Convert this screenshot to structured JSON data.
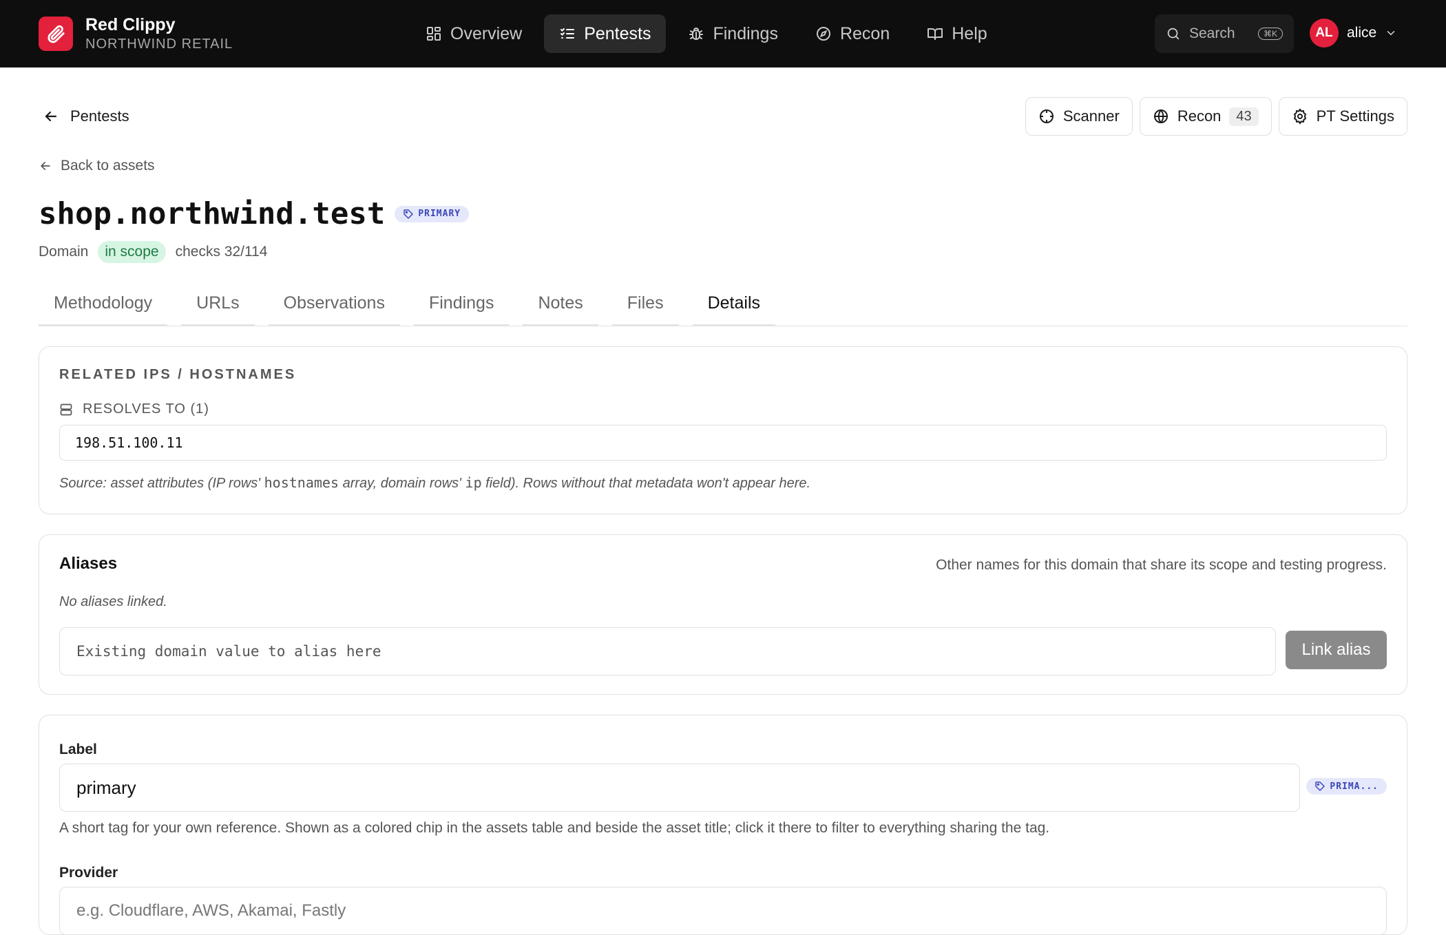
{
  "brand": {
    "name": "Red Clippy",
    "org": "NORTHWIND RETAIL"
  },
  "nav": [
    {
      "label": "Overview",
      "icon": "grid-icon",
      "active": false
    },
    {
      "label": "Pentests",
      "icon": "checklist-icon",
      "active": true
    },
    {
      "label": "Findings",
      "icon": "bug-icon",
      "active": false
    },
    {
      "label": "Recon",
      "icon": "compass-icon",
      "active": false
    },
    {
      "label": "Help",
      "icon": "book-icon",
      "active": false
    }
  ],
  "search": {
    "label": "Search",
    "shortcut": "⌘K"
  },
  "user": {
    "initials": "AL",
    "name": "alice"
  },
  "breadcrumb": {
    "label": "Pentests"
  },
  "actions": {
    "scanner": "Scanner",
    "recon": "Recon",
    "recon_count": "43",
    "settings": "PT Settings"
  },
  "back_link": "Back to assets",
  "asset": {
    "title": "shop.northwind.test",
    "chip": "PRIMARY",
    "type": "Domain",
    "scope": "in scope",
    "checks": "checks 32/114"
  },
  "tabs": [
    "Methodology",
    "URLs",
    "Observations",
    "Findings",
    "Notes",
    "Files",
    "Details"
  ],
  "active_tab": "Details",
  "related": {
    "heading": "RELATED IPS / HOSTNAMES",
    "resolves_label": "RESOLVES TO (1)",
    "ip": "198.51.100.11",
    "note_prefix": "Source: asset attributes (IP rows' ",
    "note_code1": "hostnames",
    "note_mid": " array, domain rows' ",
    "note_code2": "ip",
    "note_suffix": " field). Rows without that metadata won't appear here."
  },
  "aliases": {
    "title": "Aliases",
    "help": "Other names for this domain that share its scope and testing progress.",
    "empty": "No aliases linked.",
    "placeholder": "Existing domain value to alias here",
    "button": "Link alias"
  },
  "details": {
    "label_title": "Label",
    "label_value": "primary",
    "label_chip": "PRIMA...",
    "label_help": "A short tag for your own reference. Shown as a colored chip in the assets table and beside the asset title; click it there to filter to everything sharing the tag.",
    "provider_title": "Provider",
    "provider_placeholder": "e.g. Cloudflare, AWS, Akamai, Fastly"
  },
  "colors": {
    "accent": "#e3213d",
    "chip_bg": "#e5e8fb",
    "chip_text": "#3c46b8",
    "scope_bg": "#d6f5e3",
    "scope_text": "#1f7a45"
  }
}
